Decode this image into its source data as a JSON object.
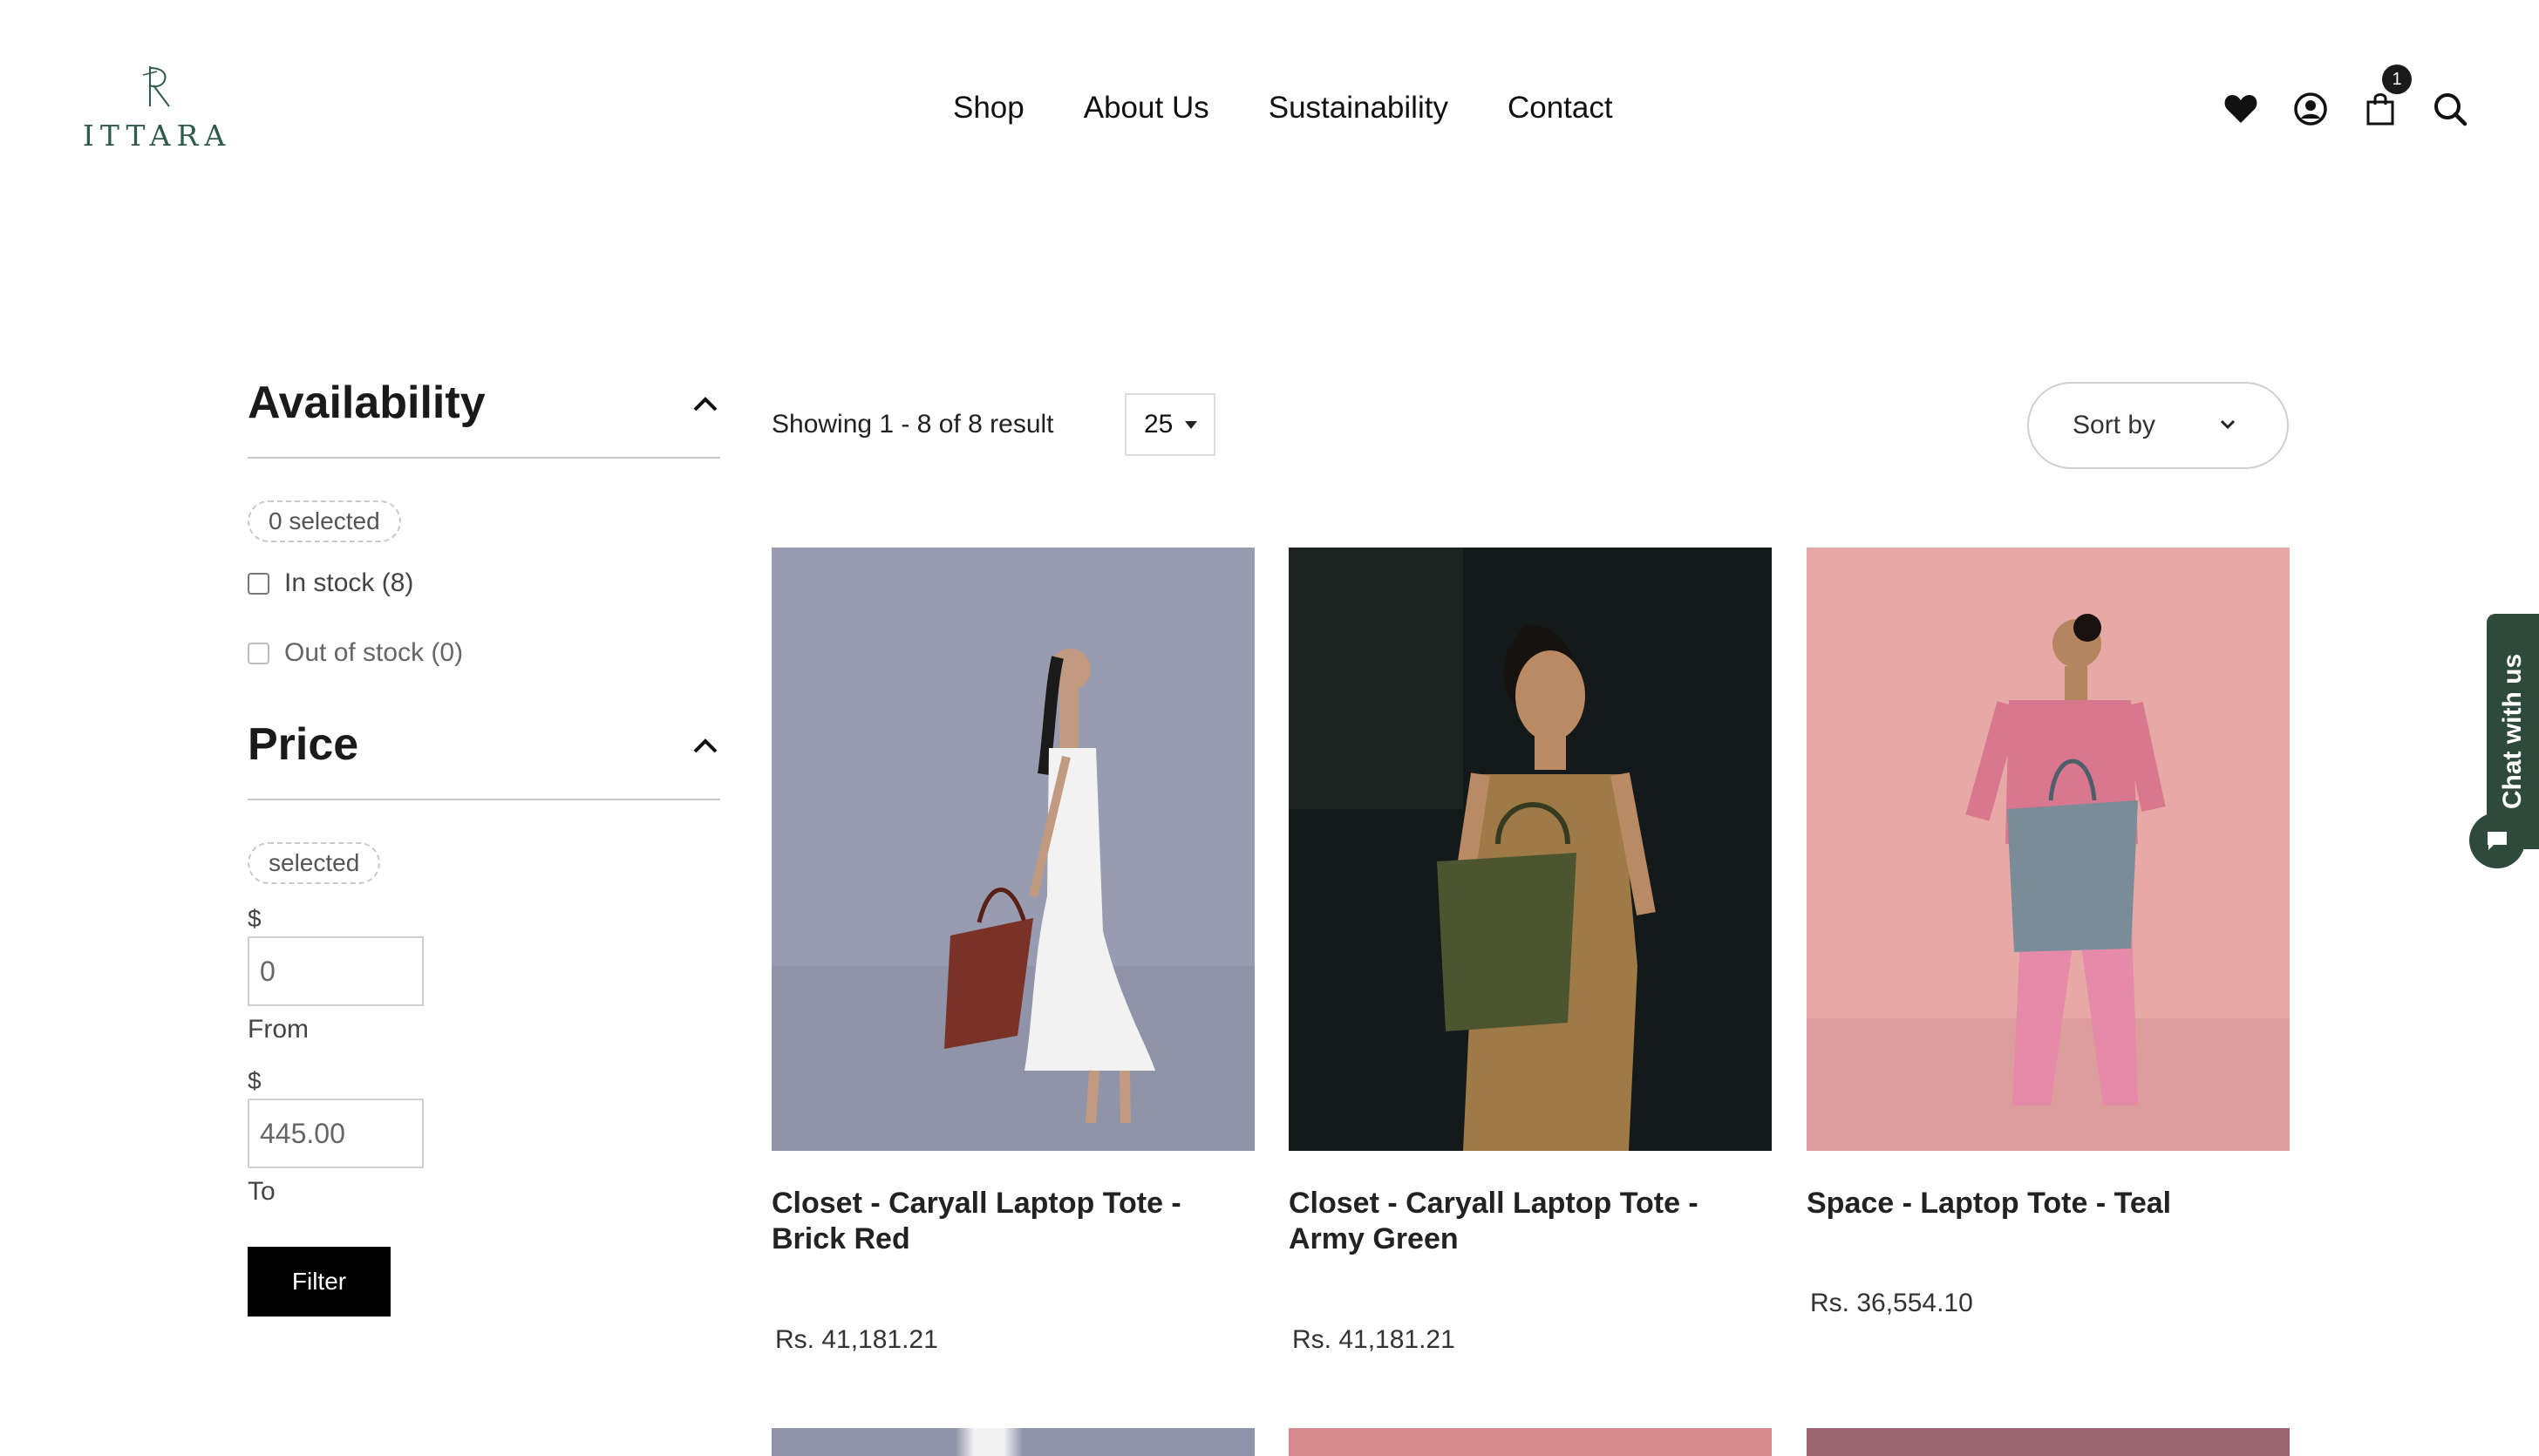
{
  "brand": {
    "name": "ITTARA",
    "logo_icon": "ittara-monogram-icon",
    "color": "#2e5b4c"
  },
  "nav": [
    "Shop",
    "About Us",
    "Sustainability",
    "Contact"
  ],
  "header_icons": {
    "wishlist": "heart-icon",
    "account": "user-circle-icon",
    "cart": "shopping-bag-icon",
    "cart_count": "1",
    "search": "search-icon"
  },
  "filters": {
    "availability": {
      "title": "Availability",
      "selected_text": "0 selected",
      "options": [
        {
          "label": "In stock (8)",
          "checked": false
        },
        {
          "label": "Out of stock (0)",
          "checked": false,
          "disabled": true
        }
      ]
    },
    "price": {
      "title": "Price",
      "selected_text": "selected",
      "currency": "$",
      "from_value": "0",
      "from_label": "From",
      "to_value": "445.00",
      "to_label": "To",
      "button": "Filter"
    }
  },
  "toolbar": {
    "results": "Showing 1 - 8 of 8 result",
    "per_page": "25",
    "sort_label": "Sort by"
  },
  "products": [
    {
      "name": "Closet - Caryall Laptop Tote - Brick Red",
      "price": "Rs. 41,181.21",
      "bag_color": "#7a3226",
      "bg": "#979cb0"
    },
    {
      "name": "Closet - Caryall Laptop Tote - Army Green",
      "price": "Rs. 41,181.21",
      "bag_color": "#4d5530",
      "bg": "#141a1a"
    },
    {
      "name": "Space - Laptop Tote - Teal",
      "price": "Rs. 36,554.10",
      "bag_color": "#7a8c98",
      "bg": "#e6a9a6"
    }
  ],
  "chat": {
    "label": "Chat with us",
    "icon": "chat-bubble-icon",
    "color": "#2d4a3a"
  }
}
